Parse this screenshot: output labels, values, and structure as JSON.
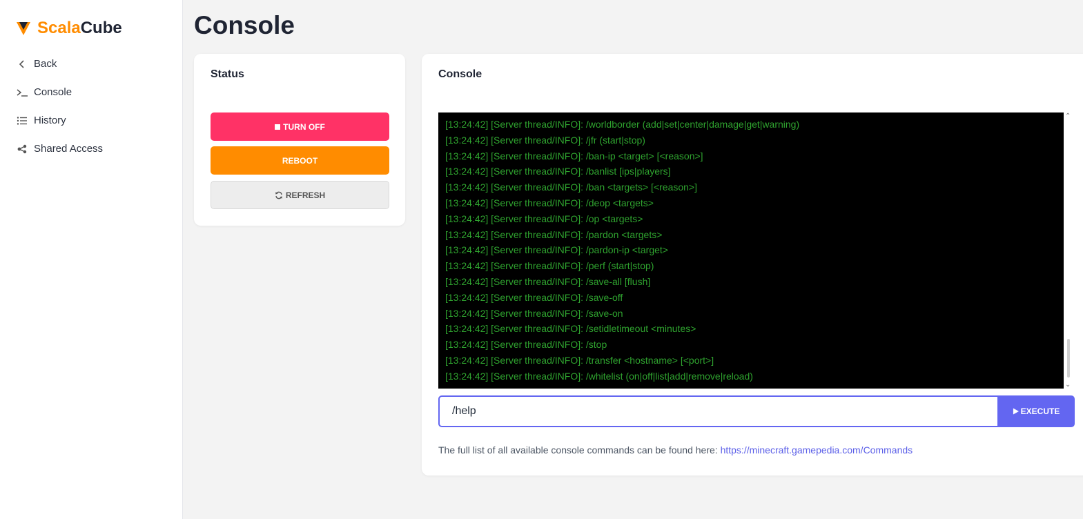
{
  "brand": {
    "part1": "Scala",
    "part2": "Cube"
  },
  "sidebar": {
    "items": [
      {
        "label": "Back",
        "icon": "chevron-left-icon"
      },
      {
        "label": "Console",
        "icon": "terminal-icon"
      },
      {
        "label": "History",
        "icon": "list-icon"
      },
      {
        "label": "Shared Access",
        "icon": "share-icon"
      }
    ]
  },
  "page": {
    "title": "Console"
  },
  "status": {
    "title": "Status",
    "turn_off": "TURN OFF",
    "reboot": "REBOOT",
    "refresh": "REFRESH"
  },
  "console": {
    "title": "Console",
    "lines": [
      "[13:24:42] [Server thread/INFO]: /worldborder (add|set|center|damage|get|warning)",
      "[13:24:42] [Server thread/INFO]: /jfr (start|stop)",
      "[13:24:42] [Server thread/INFO]: /ban-ip <target> [<reason>]",
      "[13:24:42] [Server thread/INFO]: /banlist [ips|players]",
      "[13:24:42] [Server thread/INFO]: /ban <targets> [<reason>]",
      "[13:24:42] [Server thread/INFO]: /deop <targets>",
      "[13:24:42] [Server thread/INFO]: /op <targets>",
      "[13:24:42] [Server thread/INFO]: /pardon <targets>",
      "[13:24:42] [Server thread/INFO]: /pardon-ip <target>",
      "[13:24:42] [Server thread/INFO]: /perf (start|stop)",
      "[13:24:42] [Server thread/INFO]: /save-all [flush]",
      "[13:24:42] [Server thread/INFO]: /save-off",
      "[13:24:42] [Server thread/INFO]: /save-on",
      "[13:24:42] [Server thread/INFO]: /setidletimeout <minutes>",
      "[13:24:42] [Server thread/INFO]: /stop",
      "[13:24:42] [Server thread/INFO]: /transfer <hostname> [<port>]",
      "[13:24:42] [Server thread/INFO]: /whitelist (on|off|list|add|remove|reload)"
    ],
    "input_value": "/help",
    "execute": "EXECUTE",
    "hint_text": "The full list of all available console commands can be found here: ",
    "hint_link": "https://minecraft.gamepedia.com/Commands"
  },
  "colors": {
    "accent": "#6366f1",
    "turn_off": "#ff3266",
    "reboot": "#ff8c00",
    "console_text": "#2fa32f",
    "brand_orange": "#ff8c00"
  }
}
